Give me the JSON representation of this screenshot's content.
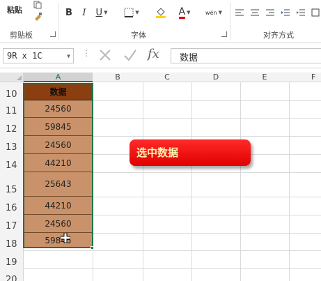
{
  "ribbon": {
    "paste_label": "粘贴",
    "clipboard_group": "剪贴板",
    "font_group": "字体",
    "align_group": "对齐方式",
    "bold": "B",
    "italic": "I",
    "underline": "U",
    "font_color_letter": "A",
    "wen": "wén"
  },
  "formula_bar": {
    "name_box": "9R x 1C",
    "content": "数据",
    "fx": "fx"
  },
  "columns": [
    "A",
    "B",
    "C",
    "D",
    "E",
    "F"
  ],
  "rows": [
    "10",
    "11",
    "12",
    "13",
    "14",
    "15",
    "16",
    "17",
    "18",
    "19",
    "20"
  ],
  "column_a": {
    "header": "数据",
    "values": [
      "24560",
      "59845",
      "24560",
      "44210",
      "25643",
      "44210",
      "24560",
      "59845"
    ]
  },
  "callout": "选中数据",
  "colors": {
    "header_fill": "#8b3e0f",
    "data_fill": "#c9926a",
    "selection": "#217346",
    "callout": "#ff1f1f"
  }
}
